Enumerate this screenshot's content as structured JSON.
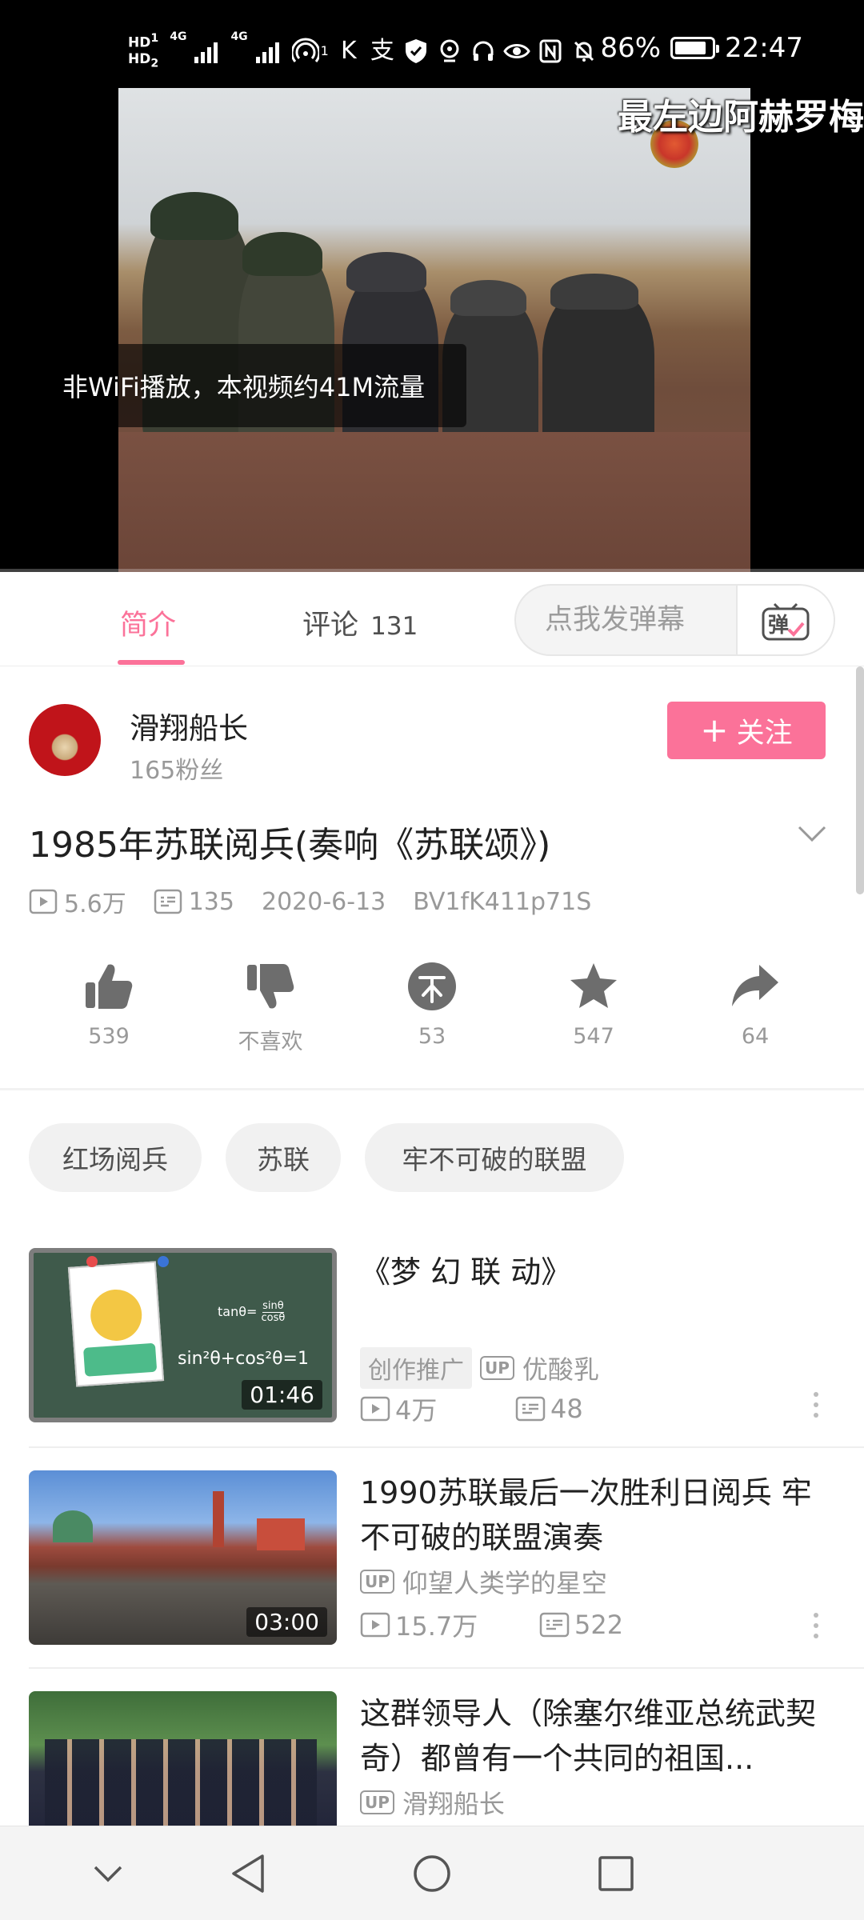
{
  "status_bar": {
    "hd1": "HD",
    "hd1_sub": "1",
    "hd2": "HD",
    "hd2_sub": "2",
    "net1": "4G",
    "net2": "4G",
    "wifi_sub": "1",
    "app_icon_1": "K",
    "app_icon_2": "支",
    "battery": "86%",
    "battery_level": 0.86,
    "time": "22:47"
  },
  "player": {
    "subtitle_overlay": "最左边阿赫罗梅",
    "toast": "非WiFi播放，本视频约41M流量"
  },
  "tabs": {
    "intro": "简介",
    "comments": "评论",
    "comments_count": "131"
  },
  "danmaku": {
    "placeholder": "点我发弹幕",
    "button_glyph": "弹"
  },
  "uploader": {
    "name": "滑翔船长",
    "fans": "165粉丝",
    "follow_label": "关注"
  },
  "video": {
    "title": "1985年苏联阅兵(奏响《苏联颂》)",
    "views": "5.6万",
    "danmaku_count": "135",
    "date": "2020-6-13",
    "bvid": "BV1fK411p71S"
  },
  "actions": {
    "like": "539",
    "dislike": "不喜欢",
    "coin": "53",
    "favorite": "547",
    "share": "64"
  },
  "tags": [
    "红场阅兵",
    "苏联",
    "牢不可破的联盟"
  ],
  "related": [
    {
      "title": "《梦 幻 联 动》",
      "promo": "创作推广",
      "up_badge": "UP",
      "owner": "优酸乳",
      "views": "4万",
      "danmaku": "48",
      "duration": "01:46",
      "thumb_text_1": "tanθ=",
      "thumb_text_1b": "sinθ",
      "thumb_text_1c": "cosθ",
      "thumb_text_2": "sin²θ+cos²θ=1"
    },
    {
      "title": "1990苏联最后一次胜利日阅兵 牢不可破的联盟演奏",
      "up_badge": "UP",
      "owner": "仰望人类学的星空",
      "views": "15.7万",
      "danmaku": "522",
      "duration": "03:00"
    },
    {
      "title": "这群领导人（除塞尔维亚总统武契奇）都曾有一个共同的祖国...",
      "up_badge": "UP",
      "owner": "滑翔船长"
    }
  ],
  "colors": {
    "accent": "#fb7299",
    "text": "#212121",
    "muted": "#999999"
  }
}
